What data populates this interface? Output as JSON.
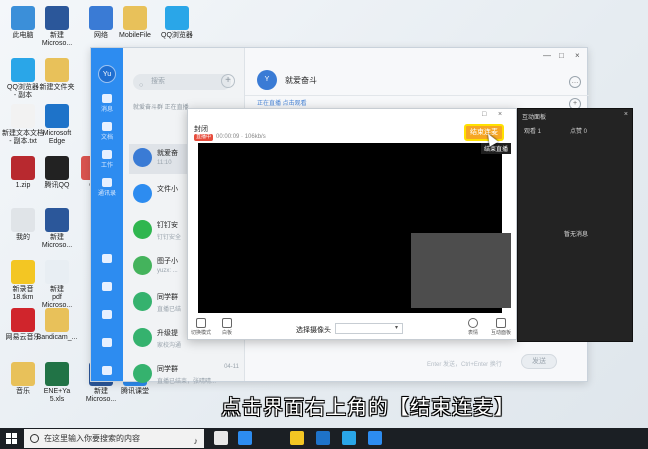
{
  "desktop": {
    "icons": [
      {
        "label": "此电脑",
        "color": "#3b8fd9"
      },
      {
        "label": "新建\nMicroso...",
        "color": "#2b579a"
      },
      {
        "label": "网络",
        "color": "#3a7bd5"
      },
      {
        "label": "MobileFile",
        "color": "#e8c15a"
      },
      {
        "label": "QQ浏览器",
        "color": "#2aa6e8"
      },
      {
        "label": "QQ浏览器\n- 副本",
        "color": "#2aa6e8"
      },
      {
        "label": "新建文件夹",
        "color": "#e8c15a"
      },
      {
        "label": "新建文本文档\n- 副本.txt",
        "color": "#f2f2f2"
      },
      {
        "label": "Microsoft\nEdge",
        "color": "#1e73c9"
      },
      {
        "label": "1.zip",
        "color": "#b8292f"
      },
      {
        "label": "腾讯QQ",
        "color": "#222222"
      },
      {
        "label": "QI",
        "color": "#d9534f"
      },
      {
        "label": "我的",
        "color": "#e0e4e8"
      },
      {
        "label": "新建\nMicroso...",
        "color": "#2b579a"
      },
      {
        "label": "新录音\n18.tkm",
        "color": "#f3c623"
      },
      {
        "label": "新建\npdf\nMicroso...",
        "color": "#e8eef3"
      },
      {
        "label": "网易云音乐",
        "color": "#d0252c"
      },
      {
        "label": "Bandicam_...",
        "color": "#e8c15a"
      },
      {
        "label": "音乐",
        "color": "#e8c15a"
      },
      {
        "label": "ENE+Ya\n5.xls",
        "color": "#217346"
      },
      {
        "label": "新建\nMicroso...",
        "color": "#2b579a"
      },
      {
        "label": "腾讯课堂",
        "color": "#2d8cf0"
      }
    ]
  },
  "im": {
    "avatar_text": "Yu",
    "sidebar": [
      {
        "label": "消息"
      },
      {
        "label": "文档"
      },
      {
        "label": "工作"
      },
      {
        "label": "通讯录"
      }
    ],
    "search_placeholder": "搜索",
    "add_label": "+",
    "notice": "就爱奋斗群 正在直播",
    "conversations": [
      {
        "name": "就爱奋",
        "sub": "11:10",
        "time": "",
        "color": "#3a7bd5"
      },
      {
        "name": "文件小",
        "sub": "",
        "time": "",
        "color": "#2d8cf0"
      },
      {
        "name": "钉钉安",
        "sub": "钉钉安全",
        "time": "",
        "color": "#2fb64f"
      },
      {
        "name": "图子小",
        "sub": "yuzx: ...",
        "time": "",
        "color": "#44b35c"
      },
      {
        "name": "同学群",
        "sub": "直播已结",
        "time": "",
        "color": "#35b26e"
      },
      {
        "name": "升级提",
        "sub": "家校沟通",
        "time": "",
        "color": "#35b26e"
      },
      {
        "name": "同学群",
        "sub": "直播已结束，张晴晴...",
        "time": "04-11",
        "color": "#35b26e"
      }
    ],
    "chat_title": "就爱奋斗",
    "chat_sub": "正在直播 点击观看",
    "input_hint": "Enter 发送，Ctrl+Enter 换行",
    "send_label": "发送",
    "win_ctrl": {
      "min": "—",
      "max": "□",
      "close": "×"
    }
  },
  "live": {
    "title": "封闭",
    "rec_tag": "直播中",
    "rec_info": "00:00:09 · 106kb/s",
    "end_label": "结束连麦",
    "tooltip": "结束直播",
    "tools": [
      {
        "label": "切换模式"
      },
      {
        "label": "白板"
      },
      {
        "label": "表情"
      },
      {
        "label": "互动面板"
      }
    ],
    "camera_label": "选择摄像头",
    "camera_value": "▾",
    "ctrl": {
      "min": "□",
      "close": "×"
    }
  },
  "panel": {
    "title": "互动面板",
    "tab1": "观看 1",
    "tab2": "点赞 0",
    "empty": "暂无消息",
    "close": "×"
  },
  "caption": "点击界面右上角的【结束连麦】",
  "taskbar": {
    "search_placeholder": "在这里输入你要搜索的内容",
    "apps": [
      {
        "name": "task-view",
        "color": "#e8e8e8"
      },
      {
        "name": "mail",
        "color": "#2d8cf0"
      },
      {
        "name": "store",
        "color": "#f3c623"
      },
      {
        "name": "edge",
        "color": "#1e73c9"
      },
      {
        "name": "qq-browser",
        "color": "#2aa6e8"
      },
      {
        "name": "tencent-classroom",
        "color": "#2d8cf0"
      }
    ]
  }
}
